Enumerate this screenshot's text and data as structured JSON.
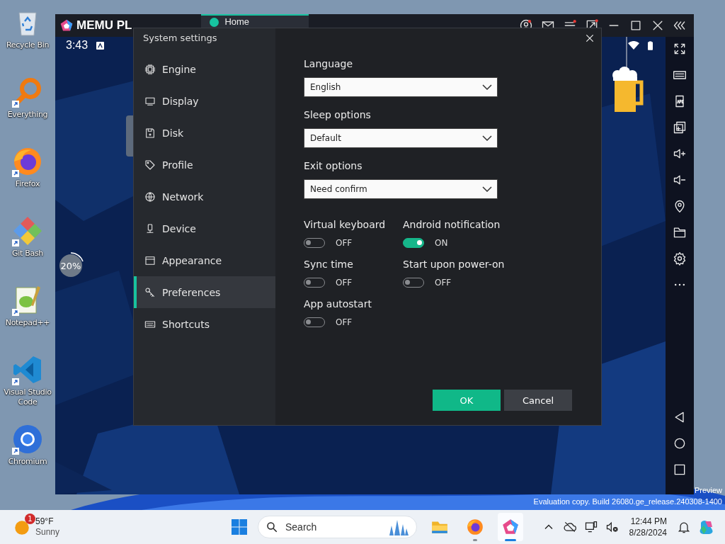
{
  "desktop": {
    "icons": [
      {
        "label": "Recycle Bin",
        "kind": "recycle",
        "shortcut": false
      },
      {
        "label": "Everything",
        "kind": "everything",
        "shortcut": true
      },
      {
        "label": "Firefox",
        "kind": "firefox",
        "shortcut": true
      },
      {
        "label": "Git Bash",
        "kind": "gitbash",
        "shortcut": true
      },
      {
        "label": "Notepad++",
        "kind": "notepad",
        "shortcut": true
      },
      {
        "label": "Visual Studio Code",
        "kind": "vscode",
        "shortcut": true
      },
      {
        "label": "Chromium",
        "kind": "chromium",
        "shortcut": true
      }
    ],
    "watermark": [
      "Preview",
      "Evaluation copy. Build 26080.ge_release.240308-1400"
    ]
  },
  "emulator": {
    "logo": "MEMU PL",
    "tab": "Home",
    "status_time": "3:43",
    "progress": "20%"
  },
  "dialog": {
    "title": "System settings",
    "nav": [
      {
        "label": "Engine",
        "kind": "chip",
        "selected": false
      },
      {
        "label": "Display",
        "kind": "monitor",
        "selected": false
      },
      {
        "label": "Disk",
        "kind": "floppy",
        "selected": false
      },
      {
        "label": "Profile",
        "kind": "tag",
        "selected": false
      },
      {
        "label": "Network",
        "kind": "globe",
        "selected": false
      },
      {
        "label": "Device",
        "kind": "device",
        "selected": false
      },
      {
        "label": "Appearance",
        "kind": "window",
        "selected": false
      },
      {
        "label": "Preferences",
        "kind": "wrench",
        "selected": true
      },
      {
        "label": "Shortcuts",
        "kind": "keyboard",
        "selected": false
      }
    ],
    "dropdowns": [
      {
        "label": "Language",
        "value": "English"
      },
      {
        "label": "Sleep options",
        "value": "Default"
      },
      {
        "label": "Exit options",
        "value": "Need confirm"
      }
    ],
    "toggles": [
      {
        "label": "Virtual keyboard",
        "on": false,
        "state": "OFF"
      },
      {
        "label": "Android notification",
        "on": true,
        "state": "ON"
      },
      {
        "label": "Sync time",
        "on": false,
        "state": "OFF"
      },
      {
        "label": "Start upon power-on",
        "on": false,
        "state": "OFF"
      },
      {
        "label": "App autostart",
        "on": false,
        "state": "OFF"
      }
    ],
    "buttons": [
      {
        "label": "OK",
        "kind": "primary"
      },
      {
        "label": "Cancel",
        "kind": "secondary"
      }
    ]
  },
  "taskbar": {
    "weather": {
      "badge": "1",
      "temperature": "59°F",
      "condition": "Sunny"
    },
    "search": {
      "placeholder": "Search"
    },
    "apps": [
      {
        "kind": "files",
        "running": false,
        "selected": false
      },
      {
        "kind": "firefox",
        "running": true,
        "selected": false
      },
      {
        "kind": "memu",
        "running": true,
        "selected": true
      }
    ],
    "clock": {
      "time": "12:44 PM",
      "date": "8/28/2024"
    }
  }
}
